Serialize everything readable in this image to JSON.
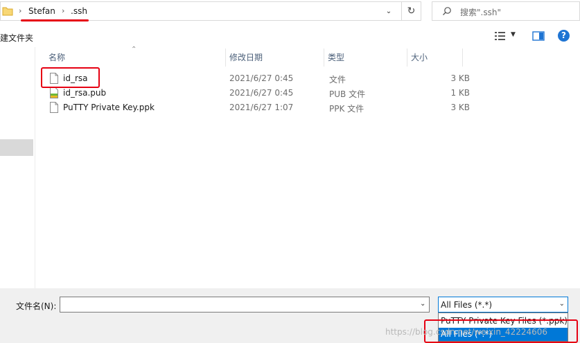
{
  "address": {
    "crumbs": [
      "Stefan",
      ".ssh"
    ],
    "separator": "›",
    "search_placeholder": "搜索\".ssh\""
  },
  "toolbar": {
    "new_folder_label": "建文件夹"
  },
  "columns": {
    "name": "名称",
    "date": "修改日期",
    "type": "类型",
    "size": "大小"
  },
  "files": [
    {
      "name": "id_rsa",
      "date": "2021/6/27 0:45",
      "type": "文件",
      "size": "3 KB",
      "icon": "blank-file-icon"
    },
    {
      "name": "id_rsa.pub",
      "date": "2021/6/27 0:45",
      "type": "PUB 文件",
      "size": "1 KB",
      "icon": "pub-file-icon"
    },
    {
      "name": "PuTTY Private Key.ppk",
      "date": "2021/6/27 1:07",
      "type": "PPK 文件",
      "size": "3 KB",
      "icon": "blank-file-icon"
    }
  ],
  "bottom": {
    "filename_label": "文件名(N):",
    "filename_value": "",
    "filetype_selected": "All Files (*.*)",
    "filetype_options": [
      "PuTTY Private Key Files (*.ppk)",
      "All Files (*.*)"
    ]
  },
  "watermark": "https://blog.csdn.net/weixin_42224606",
  "colors": {
    "highlight_red": "#e60012",
    "selection_blue": "#0078d7",
    "header_text": "#4c607a"
  }
}
